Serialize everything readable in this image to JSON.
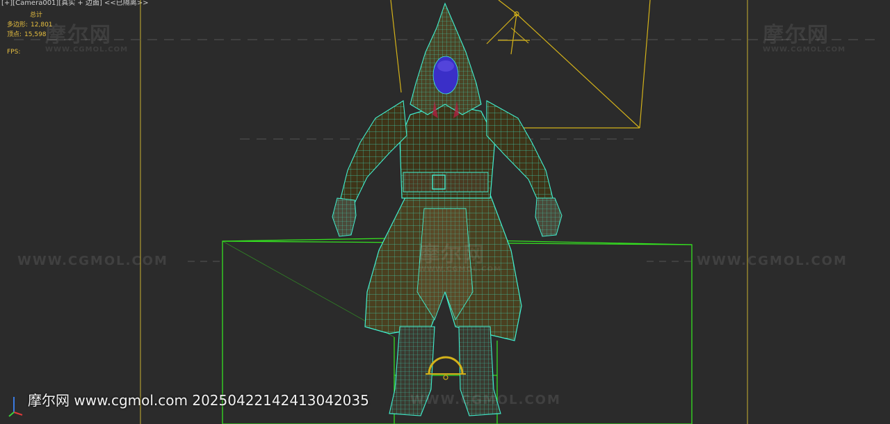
{
  "viewport": {
    "label": "[+][Camera001][真实 + 边面] <<已隔离>>"
  },
  "stats": {
    "total_label": "总计",
    "polys_label": "多边形:",
    "polys_value": "12,801",
    "verts_label": "顶点:",
    "verts_value": "15,598",
    "fps_label": "FPS:"
  },
  "watermarks": {
    "logo": "摩尔网",
    "logo_sub": "WWW.CGMOL.COM",
    "url": "WWW.CGMOL.COM",
    "footer": "摩尔网 www.cgmol.com 20250422142413042035"
  },
  "colors": {
    "background": "#2b2b2b",
    "stats_text": "#e8c040",
    "camera_lines": "#d4b21a",
    "bounding_box": "#35e020",
    "wireframe": "#40f0d0"
  },
  "icons": {
    "axis_gizmo": "xyz-axis-icon",
    "camera": "camera-icon"
  }
}
